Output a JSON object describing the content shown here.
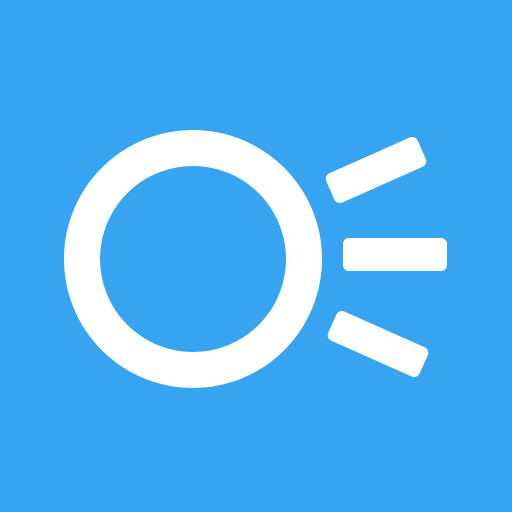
{
  "icon": {
    "name": "circle-with-rays-logo",
    "colors": {
      "background": "#36a4f0",
      "foreground": "#ffffff"
    }
  }
}
